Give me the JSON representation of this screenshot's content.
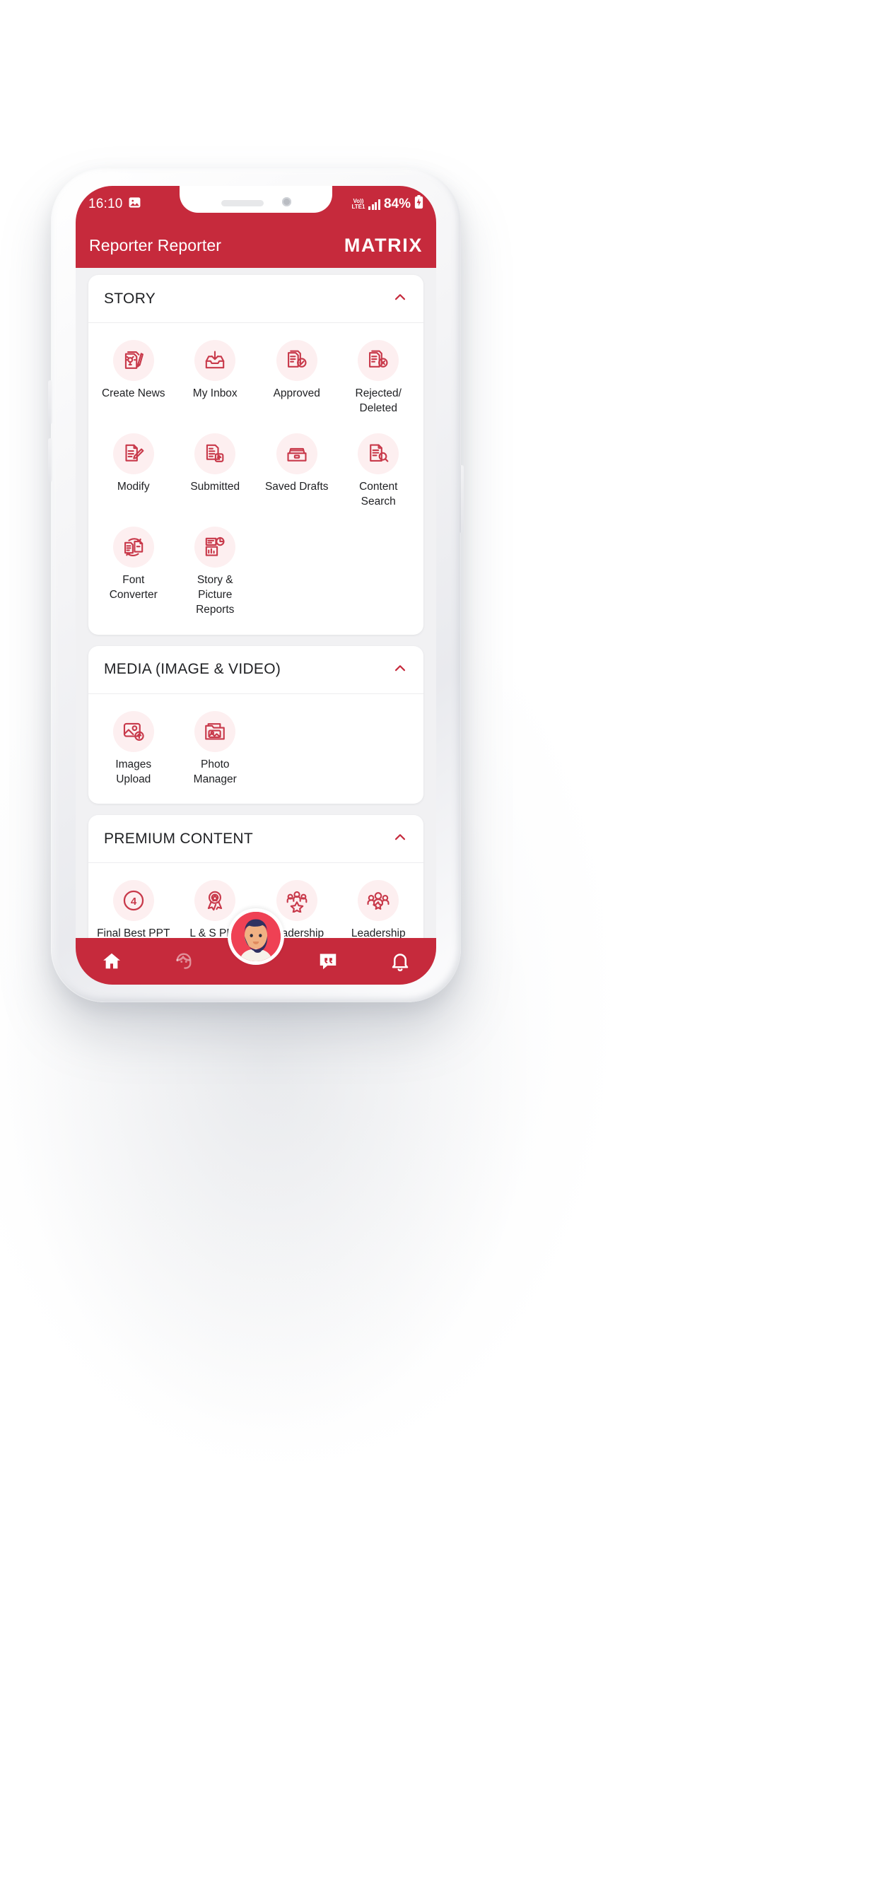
{
  "theme": {
    "brand_red": "#c62a3c",
    "icon_red": "#c8394a",
    "icon_bg": "#fdeff0",
    "page_bg": "#f1f1f3"
  },
  "status_bar": {
    "time": "16:10",
    "image_icon": "image-icon",
    "volte_top": "Vo))",
    "volte_bottom": "LTE1",
    "signal_icon": "signal-bars-icon",
    "battery_percent": "84%",
    "battery_icon": "battery-charging-icon"
  },
  "app_bar": {
    "title": "Reporter Reporter",
    "brand": "MATRIX"
  },
  "sections": [
    {
      "title": "STORY",
      "collapse_icon": "chevron-up-icon",
      "items": [
        {
          "label": "Create News",
          "icon": "create-news-icon"
        },
        {
          "label": "My Inbox",
          "icon": "inbox-download-icon"
        },
        {
          "label": "Approved",
          "icon": "document-check-icon"
        },
        {
          "label": "Rejected/\nDeleted",
          "icon": "document-cross-icon"
        },
        {
          "label": "Modify",
          "icon": "document-pencil-icon"
        },
        {
          "label": "Submitted",
          "icon": "document-upload-icon"
        },
        {
          "label": "Saved Drafts",
          "icon": "drawer-icon"
        },
        {
          "label": "Content\nSearch",
          "icon": "document-search-icon"
        },
        {
          "label": "Font\nConverter",
          "icon": "font-converter-icon"
        },
        {
          "label": "Story &\nPicture\nReports",
          "icon": "report-chart-icon"
        }
      ]
    },
    {
      "title": "MEDIA (IMAGE & VIDEO)",
      "collapse_icon": "chevron-up-icon",
      "items": [
        {
          "label": "Images\nUpload",
          "icon": "image-upload-icon"
        },
        {
          "label": "Photo\nManager",
          "icon": "photo-folder-icon"
        }
      ]
    },
    {
      "title": "PREMIUM CONTENT",
      "collapse_icon": "chevron-up-icon",
      "items": [
        {
          "label": "Final Best PPT",
          "icon": "number-four-circle-icon",
          "badge": "4"
        },
        {
          "label": "L & S PPT",
          "icon": "award-ribbon-icon"
        },
        {
          "label": "Leadership\nDetail",
          "icon": "leadership-star-icon"
        },
        {
          "label": "Leadership\nSummary",
          "icon": "group-star-icon"
        }
      ]
    }
  ],
  "bottom_nav": {
    "items": [
      {
        "name": "home",
        "icon": "home-icon",
        "active": true
      },
      {
        "name": "profile",
        "icon": "face-profile-icon",
        "active": false
      },
      {
        "name": "messages",
        "icon": "quote-bubble-icon",
        "active": false
      },
      {
        "name": "notifications",
        "icon": "bell-icon",
        "active": false
      }
    ],
    "avatar": "user-avatar"
  },
  "system_nav": {
    "recent_icon": "recent-apps-icon",
    "home_icon": "system-home-icon",
    "back_icon": "system-back-icon"
  }
}
